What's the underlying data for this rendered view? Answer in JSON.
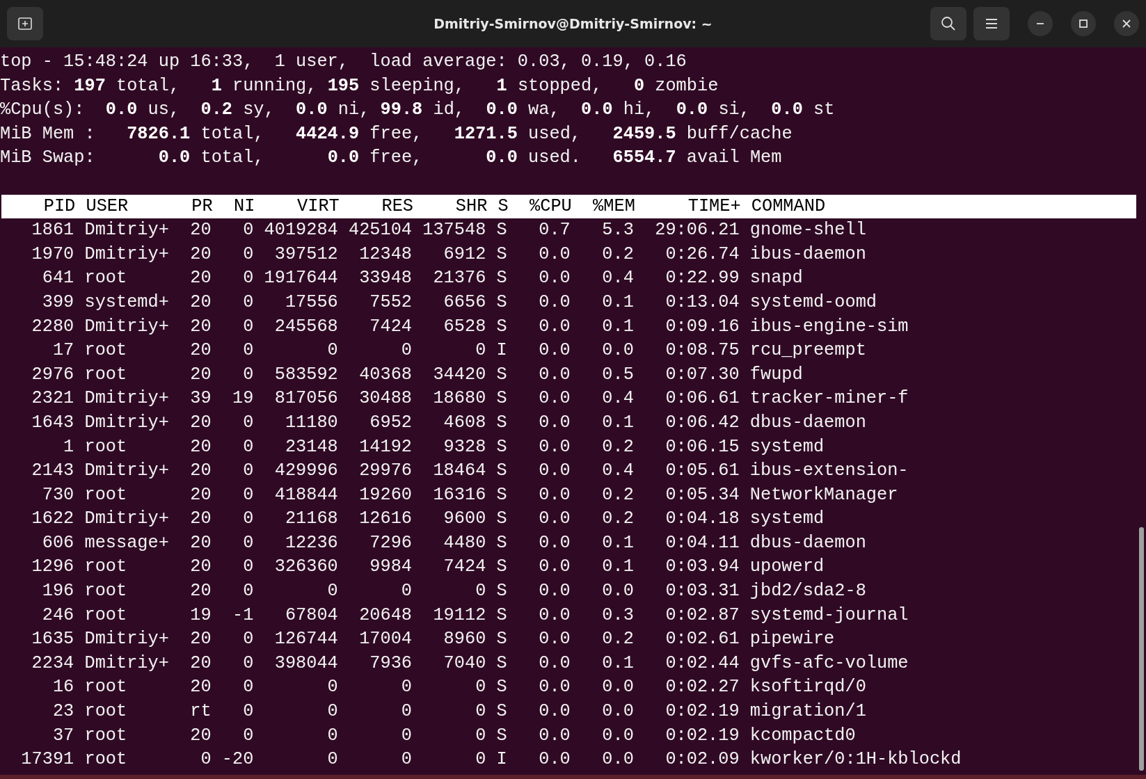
{
  "window": {
    "title": "Dmitriy-Smirnov@Dmitriy-Smirnov: ~"
  },
  "summary": [
    "top - 15:48:24 up 16:33,  1 user,  load average: 0.03, 0.19, 0.16",
    "Tasks: **197** total,   **1** running, **195** sleeping,   **1** stopped,   **0** zombie",
    "%Cpu(s):  **0.0** us,  **0.2** sy,  **0.0** ni, **99.8** id,  **0.0** wa,  **0.0** hi,  **0.0** si,  **0.0** st",
    "MiB Mem :   **7826.1** total,   **4424.9** free,   **1271.5** used,   **2459.5** buff/cache",
    "MiB Swap:      **0.0** total,      **0.0** free,      **0.0** used.   **6554.7** avail Mem"
  ],
  "table_header": "    PID USER      PR  NI    VIRT    RES    SHR S  %CPU  %MEM     TIME+ COMMAND",
  "rows": [
    "   1861 Dmitriy+  20   0 4019284 425104 137548 S   0.7   5.3  29:06.21 gnome-shell",
    "   1970 Dmitriy+  20   0  397512  12348   6912 S   0.0   0.2   0:26.74 ibus-daemon",
    "    641 root      20   0 1917644  33948  21376 S   0.0   0.4   0:22.99 snapd",
    "    399 systemd+  20   0   17556   7552   6656 S   0.0   0.1   0:13.04 systemd-oomd",
    "   2280 Dmitriy+  20   0  245568   7424   6528 S   0.0   0.1   0:09.16 ibus-engine-sim",
    "     17 root      20   0       0      0      0 I   0.0   0.0   0:08.75 rcu_preempt",
    "   2976 root      20   0  583592  40368  34420 S   0.0   0.5   0:07.30 fwupd",
    "   2321 Dmitriy+  39  19  817056  30488  18680 S   0.0   0.4   0:06.61 tracker-miner-f",
    "   1643 Dmitriy+  20   0   11180   6952   4608 S   0.0   0.1   0:06.42 dbus-daemon",
    "      1 root      20   0   23148  14192   9328 S   0.0   0.2   0:06.15 systemd",
    "   2143 Dmitriy+  20   0  429996  29976  18464 S   0.0   0.4   0:05.61 ibus-extension-",
    "    730 root      20   0  418844  19260  16316 S   0.0   0.2   0:05.34 NetworkManager",
    "   1622 Dmitriy+  20   0   21168  12616   9600 S   0.0   0.2   0:04.18 systemd",
    "    606 message+  20   0   12236   7296   4480 S   0.0   0.1   0:04.11 dbus-daemon",
    "   1296 root      20   0  326360   9984   7424 S   0.0   0.1   0:03.94 upowerd",
    "    196 root      20   0       0      0      0 S   0.0   0.0   0:03.31 jbd2/sda2-8",
    "    246 root      19  -1   67804  20648  19112 S   0.0   0.3   0:02.87 systemd-journal",
    "   1635 Dmitriy+  20   0  126744  17004   8960 S   0.0   0.2   0:02.61 pipewire",
    "   2234 Dmitriy+  20   0  398044   7936   7040 S   0.0   0.1   0:02.44 gvfs-afc-volume",
    "     16 root      20   0       0      0      0 S   0.0   0.0   0:02.27 ksoftirqd/0",
    "     23 root      rt   0       0      0      0 S   0.0   0.0   0:02.19 migration/1",
    "     37 root      20   0       0      0      0 S   0.0   0.0   0:02.19 kcompactd0",
    "  17391 root       0 -20       0      0      0 I   0.0   0.0   0:02.09 kworker/0:1H-kblockd"
  ]
}
